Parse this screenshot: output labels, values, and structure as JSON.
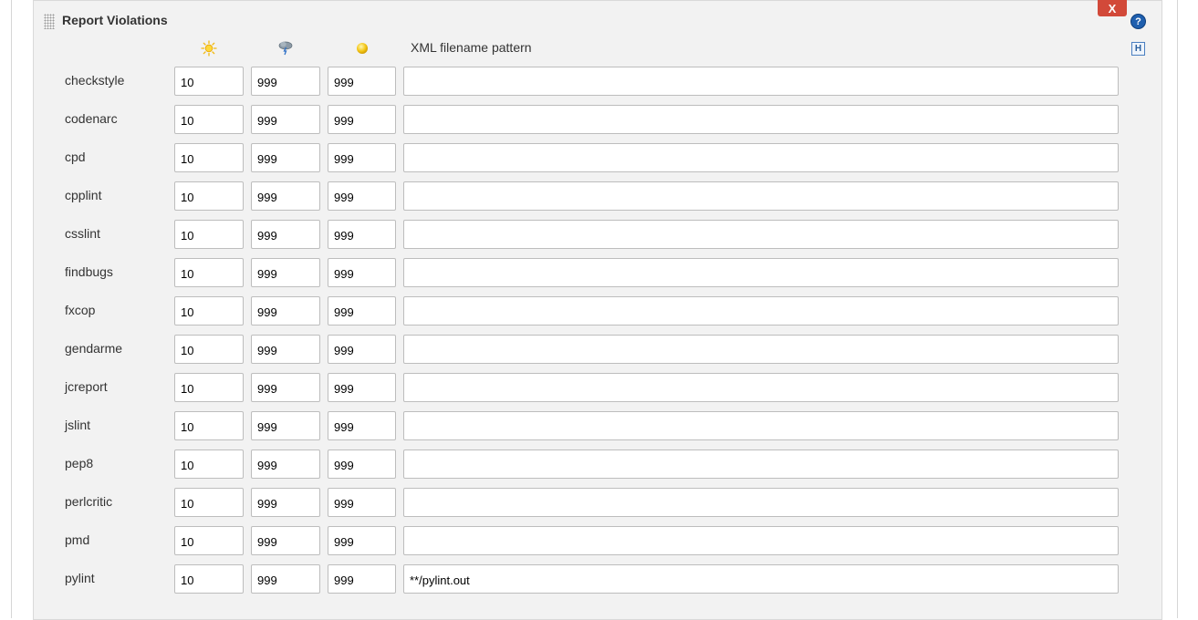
{
  "panel": {
    "title": "Report Violations",
    "delete_label": "X",
    "help_label": "?",
    "hint_label": "H"
  },
  "columns": {
    "sun_icon": "sun-icon",
    "storm_icon": "storm-cloud-icon",
    "unstable_icon": "yellow-ball-icon",
    "pattern_header": "XML filename pattern"
  },
  "colors": {
    "delete_button": "#d24939",
    "panel_background": "#f2f2f2",
    "help_icon": "#1f5fae"
  },
  "rows": [
    {
      "name": "checkstyle",
      "sunny": "10",
      "stormy": "999",
      "unstable": "999",
      "pattern": ""
    },
    {
      "name": "codenarc",
      "sunny": "10",
      "stormy": "999",
      "unstable": "999",
      "pattern": ""
    },
    {
      "name": "cpd",
      "sunny": "10",
      "stormy": "999",
      "unstable": "999",
      "pattern": ""
    },
    {
      "name": "cpplint",
      "sunny": "10",
      "stormy": "999",
      "unstable": "999",
      "pattern": ""
    },
    {
      "name": "csslint",
      "sunny": "10",
      "stormy": "999",
      "unstable": "999",
      "pattern": ""
    },
    {
      "name": "findbugs",
      "sunny": "10",
      "stormy": "999",
      "unstable": "999",
      "pattern": ""
    },
    {
      "name": "fxcop",
      "sunny": "10",
      "stormy": "999",
      "unstable": "999",
      "pattern": ""
    },
    {
      "name": "gendarme",
      "sunny": "10",
      "stormy": "999",
      "unstable": "999",
      "pattern": ""
    },
    {
      "name": "jcreport",
      "sunny": "10",
      "stormy": "999",
      "unstable": "999",
      "pattern": ""
    },
    {
      "name": "jslint",
      "sunny": "10",
      "stormy": "999",
      "unstable": "999",
      "pattern": ""
    },
    {
      "name": "pep8",
      "sunny": "10",
      "stormy": "999",
      "unstable": "999",
      "pattern": ""
    },
    {
      "name": "perlcritic",
      "sunny": "10",
      "stormy": "999",
      "unstable": "999",
      "pattern": ""
    },
    {
      "name": "pmd",
      "sunny": "10",
      "stormy": "999",
      "unstable": "999",
      "pattern": ""
    },
    {
      "name": "pylint",
      "sunny": "10",
      "stormy": "999",
      "unstable": "999",
      "pattern": "**/pylint.out"
    }
  ]
}
